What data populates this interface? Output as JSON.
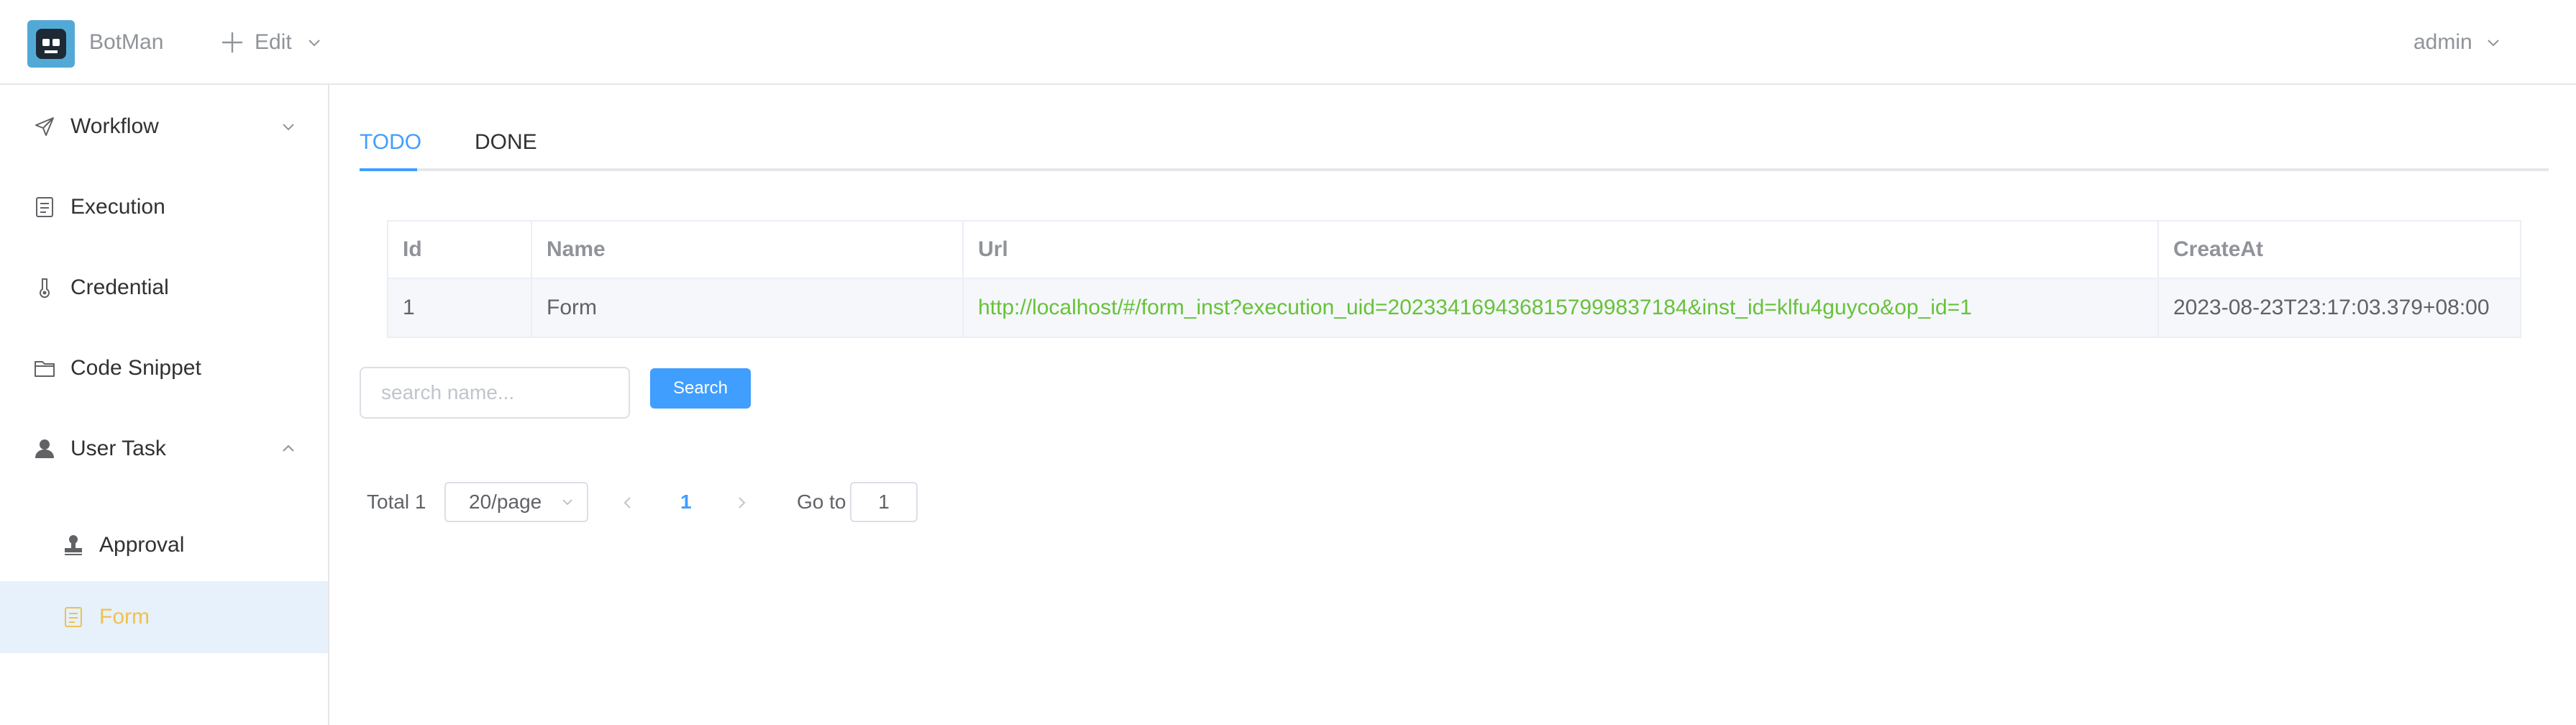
{
  "header": {
    "brand": "BotMan",
    "edit_label": "Edit",
    "user": "admin"
  },
  "sidebar": {
    "items": [
      {
        "label": "Workflow",
        "icon": "paper-plane-icon"
      },
      {
        "label": "Execution",
        "icon": "document-icon"
      },
      {
        "label": "Credential",
        "icon": "thermometer-icon"
      },
      {
        "label": "Code Snippet",
        "icon": "folder-icon"
      },
      {
        "label": "User Task",
        "icon": "user-icon"
      }
    ],
    "sub_items": [
      {
        "label": "Approval",
        "icon": "stamp-icon"
      },
      {
        "label": "Form",
        "icon": "form-icon"
      }
    ],
    "active": "Form"
  },
  "tabs": [
    {
      "label": "TODO"
    },
    {
      "label": "DONE"
    }
  ],
  "table": {
    "headers": [
      "Id",
      "Name",
      "Url",
      "CreateAt"
    ],
    "rows": [
      {
        "id": "1",
        "name": "Form",
        "url": "http://localhost/#/form_inst?execution_uid=2023341694368157999837184&inst_id=klfu4guyco&op_id=1",
        "create_at": "2023-08-23T23:17:03.379+08:00"
      }
    ]
  },
  "search": {
    "placeholder": "search name...",
    "button": "Search"
  },
  "pagination": {
    "total": "Total 1",
    "page_size": "20/page",
    "current": "1",
    "goto_label": "Go to",
    "goto_value": "1"
  },
  "colors": {
    "primary": "#409eff",
    "url_green": "#67c23a",
    "active_text": "#f0c14b",
    "active_bg": "#e6f1fc"
  }
}
